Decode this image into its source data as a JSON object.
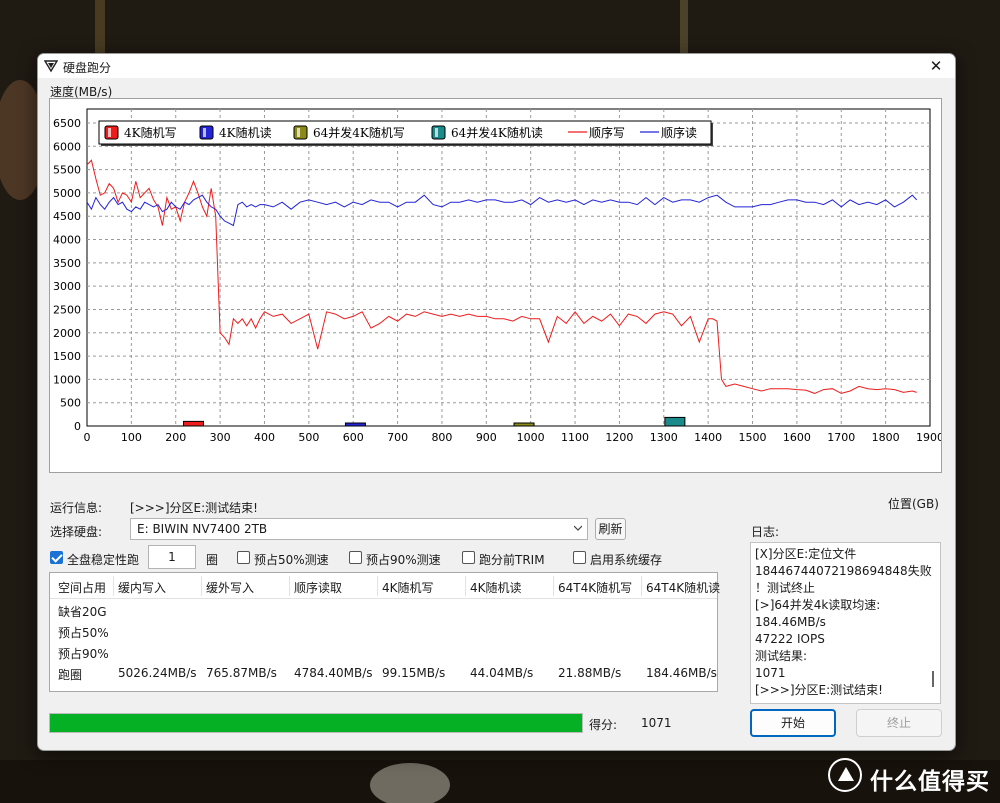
{
  "window": {
    "title": "硬盘跑分",
    "close_symbol": "✕"
  },
  "chart_data": {
    "type": "line",
    "ylabel": "速度(MB/s)",
    "xlabel": "位置(GB)",
    "xlim": [
      0,
      1900
    ],
    "ylim": [
      0,
      6800
    ],
    "x_ticks": [
      0,
      100,
      200,
      300,
      400,
      500,
      600,
      700,
      800,
      900,
      1000,
      1100,
      1200,
      1300,
      1400,
      1500,
      1600,
      1700,
      1800,
      1900
    ],
    "y_ticks": [
      0,
      500,
      1000,
      1500,
      2000,
      2500,
      3000,
      3500,
      4000,
      4500,
      5000,
      5500,
      6000,
      6500
    ],
    "grid": true,
    "legend_position": "top-left",
    "legend": [
      {
        "name": "4K随机写",
        "kind": "bar",
        "color": "#ee1c1c"
      },
      {
        "name": "4K随机读",
        "kind": "bar",
        "color": "#2323d8"
      },
      {
        "name": "64并发4K随机写",
        "kind": "bar",
        "color": "#8a8a1a"
      },
      {
        "name": "64并发4K随机读",
        "kind": "bar",
        "color": "#1a8a8a"
      },
      {
        "name": "顺序写",
        "kind": "line",
        "color": "#ee1c1c"
      },
      {
        "name": "顺序读",
        "kind": "line",
        "color": "#2323d8"
      }
    ],
    "bars": [
      {
        "series": "4K随机写",
        "x": 240,
        "value": 99.15,
        "color": "#ee1c1c"
      },
      {
        "series": "4K随机读",
        "x": 605,
        "value": 44.04,
        "color": "#2323d8"
      },
      {
        "series": "64并发4K随机写",
        "x": 985,
        "value": 21.88,
        "color": "#8a8a1a"
      },
      {
        "series": "64并发4K随机读",
        "x": 1325,
        "value": 184.46,
        "color": "#1a8a8a"
      }
    ],
    "series": [
      {
        "name": "顺序写",
        "color": "#ee1c1c",
        "x": [
          0,
          10,
          20,
          30,
          40,
          50,
          60,
          70,
          80,
          90,
          100,
          110,
          120,
          130,
          140,
          150,
          160,
          170,
          180,
          190,
          200,
          210,
          220,
          230,
          240,
          250,
          260,
          270,
          280,
          290,
          300,
          310,
          320,
          330,
          340,
          350,
          360,
          370,
          380,
          390,
          400,
          420,
          440,
          460,
          480,
          500,
          520,
          540,
          560,
          580,
          600,
          620,
          640,
          660,
          680,
          700,
          720,
          740,
          760,
          780,
          800,
          820,
          840,
          860,
          880,
          900,
          920,
          940,
          960,
          980,
          1000,
          1020,
          1040,
          1060,
          1080,
          1100,
          1120,
          1140,
          1160,
          1180,
          1200,
          1220,
          1240,
          1260,
          1280,
          1300,
          1320,
          1340,
          1360,
          1380,
          1400,
          1410,
          1420,
          1430,
          1440,
          1460,
          1480,
          1500,
          1520,
          1540,
          1560,
          1580,
          1600,
          1620,
          1640,
          1660,
          1680,
          1700,
          1720,
          1740,
          1760,
          1780,
          1800,
          1820,
          1840,
          1860,
          1870
        ],
        "values": [
          5600,
          5700,
          5300,
          4950,
          5000,
          5200,
          5100,
          4800,
          5000,
          4950,
          4800,
          5250,
          4900,
          5000,
          5100,
          4850,
          4700,
          4300,
          4900,
          4650,
          4700,
          4400,
          4800,
          5000,
          5250,
          5000,
          4700,
          4500,
          5100,
          4500,
          2000,
          1900,
          1750,
          2300,
          2200,
          2300,
          2150,
          2300,
          2100,
          2300,
          2450,
          2350,
          2400,
          2200,
          2300,
          2400,
          1650,
          2450,
          2400,
          2300,
          2350,
          2450,
          2100,
          2200,
          2350,
          2250,
          2400,
          2350,
          2450,
          2400,
          2350,
          2400,
          2350,
          2400,
          2350,
          2350,
          2300,
          2300,
          2250,
          2350,
          2300,
          2300,
          1800,
          2350,
          2200,
          2450,
          2200,
          2350,
          2250,
          2400,
          2150,
          2400,
          2350,
          2200,
          2400,
          2450,
          2400,
          2150,
          2350,
          1800,
          2300,
          2300,
          2250,
          1000,
          850,
          900,
          850,
          800,
          750,
          800,
          800,
          800,
          780,
          770,
          700,
          780,
          800,
          700,
          750,
          850,
          800,
          780,
          800,
          780,
          720,
          750,
          720
        ],
        "note": "approximate read from plot"
      },
      {
        "name": "顺序读",
        "color": "#2323d8",
        "x": [
          0,
          10,
          20,
          30,
          40,
          50,
          60,
          70,
          80,
          90,
          100,
          110,
          120,
          130,
          140,
          150,
          160,
          170,
          180,
          190,
          200,
          210,
          220,
          230,
          240,
          250,
          260,
          270,
          280,
          290,
          300,
          310,
          320,
          330,
          340,
          350,
          360,
          370,
          380,
          390,
          400,
          420,
          440,
          460,
          480,
          500,
          520,
          540,
          560,
          580,
          600,
          620,
          640,
          660,
          680,
          700,
          720,
          740,
          760,
          780,
          800,
          820,
          840,
          860,
          880,
          900,
          920,
          940,
          960,
          980,
          1000,
          1020,
          1040,
          1060,
          1080,
          1100,
          1120,
          1140,
          1160,
          1180,
          1200,
          1220,
          1240,
          1260,
          1280,
          1300,
          1320,
          1340,
          1360,
          1380,
          1400,
          1420,
          1440,
          1460,
          1480,
          1500,
          1520,
          1540,
          1560,
          1580,
          1600,
          1620,
          1640,
          1660,
          1680,
          1700,
          1720,
          1740,
          1760,
          1780,
          1800,
          1820,
          1840,
          1860,
          1870
        ],
        "values": [
          4800,
          4650,
          4900,
          4750,
          4650,
          4800,
          4900,
          4750,
          4800,
          4650,
          4600,
          4700,
          4650,
          4800,
          4750,
          4700,
          4750,
          4600,
          4650,
          4800,
          4700,
          4650,
          4800,
          4750,
          4850,
          4900,
          4950,
          4800,
          4700,
          4650,
          4500,
          4400,
          4350,
          4300,
          4750,
          4800,
          4700,
          4750,
          4700,
          4750,
          4750,
          4700,
          4800,
          4650,
          4800,
          4850,
          4800,
          4750,
          4800,
          4700,
          4800,
          4750,
          4850,
          4800,
          4800,
          4700,
          4800,
          4800,
          4950,
          4750,
          4700,
          4800,
          4800,
          4850,
          4800,
          4850,
          4850,
          4800,
          4800,
          4850,
          4750,
          4900,
          4800,
          4850,
          4800,
          4850,
          4750,
          4850,
          4800,
          4850,
          4800,
          4800,
          4750,
          4900,
          4750,
          4900,
          4800,
          4850,
          4850,
          4800,
          4900,
          4950,
          4800,
          4700,
          4700,
          4700,
          4750,
          4750,
          4800,
          4850,
          4850,
          4800,
          4800,
          4750,
          4850,
          4700,
          4850,
          4750,
          4800,
          4750,
          4850,
          4700,
          4800,
          4950,
          4850
        ],
        "note": "approximate read from plot"
      }
    ]
  },
  "run_info": {
    "label": "运行信息:",
    "message": "[>>>]分区E:测试结束!"
  },
  "disk": {
    "label": "选择硬盘:",
    "selected": "E: BIWIN NV7400 2TB",
    "refresh": "刷新"
  },
  "log_label": "日志:",
  "options": {
    "full_disk": {
      "label": "全盘稳定性跑",
      "checked": true
    },
    "laps_value": "1",
    "laps_unit": "圈",
    "prefill50": {
      "label": "预占50%测速",
      "checked": false
    },
    "prefill90": {
      "label": "预占90%测速",
      "checked": false
    },
    "trim": {
      "label": "跑分前TRIM",
      "checked": false
    },
    "cache": {
      "label": "启用系统缓存",
      "checked": false
    }
  },
  "table": {
    "headers": [
      "空间占用",
      "缓内写入",
      "缓外写入",
      "顺序读取",
      "4K随机写",
      "4K随机读",
      "64T4K随机写",
      "64T4K随机读"
    ],
    "rows": [
      {
        "label": "缺省20G",
        "cells": [
          "",
          "",
          "",
          "",
          "",
          "",
          ""
        ]
      },
      {
        "label": "预占50%",
        "cells": [
          "",
          "",
          "",
          "",
          "",
          "",
          ""
        ]
      },
      {
        "label": "预占90%",
        "cells": [
          "",
          "",
          "",
          "",
          "",
          "",
          ""
        ]
      },
      {
        "label": "跑圈",
        "cells": [
          "5026.24MB/s",
          "765.87MB/s",
          "4784.40MB/s",
          "99.15MB/s",
          "44.04MB/s",
          "21.88MB/s",
          "184.46MB/s"
        ]
      }
    ]
  },
  "log": [
    "[X]分区E:定位文件",
    "18446744072198694848失败",
    "！测试终止",
    "[>]64并发4k读取均速:",
    "184.46MB/s",
    "47222 IOPS",
    "测试结果:",
    "1071",
    "[>>>]分区E:测试结束!"
  ],
  "progress": {
    "value": 1.0,
    "color": "#06b025"
  },
  "score": {
    "label": "得分:",
    "value": "1071"
  },
  "buttons": {
    "start": "开始",
    "stop": "终止"
  },
  "watermark": {
    "text": "什么值得买"
  }
}
